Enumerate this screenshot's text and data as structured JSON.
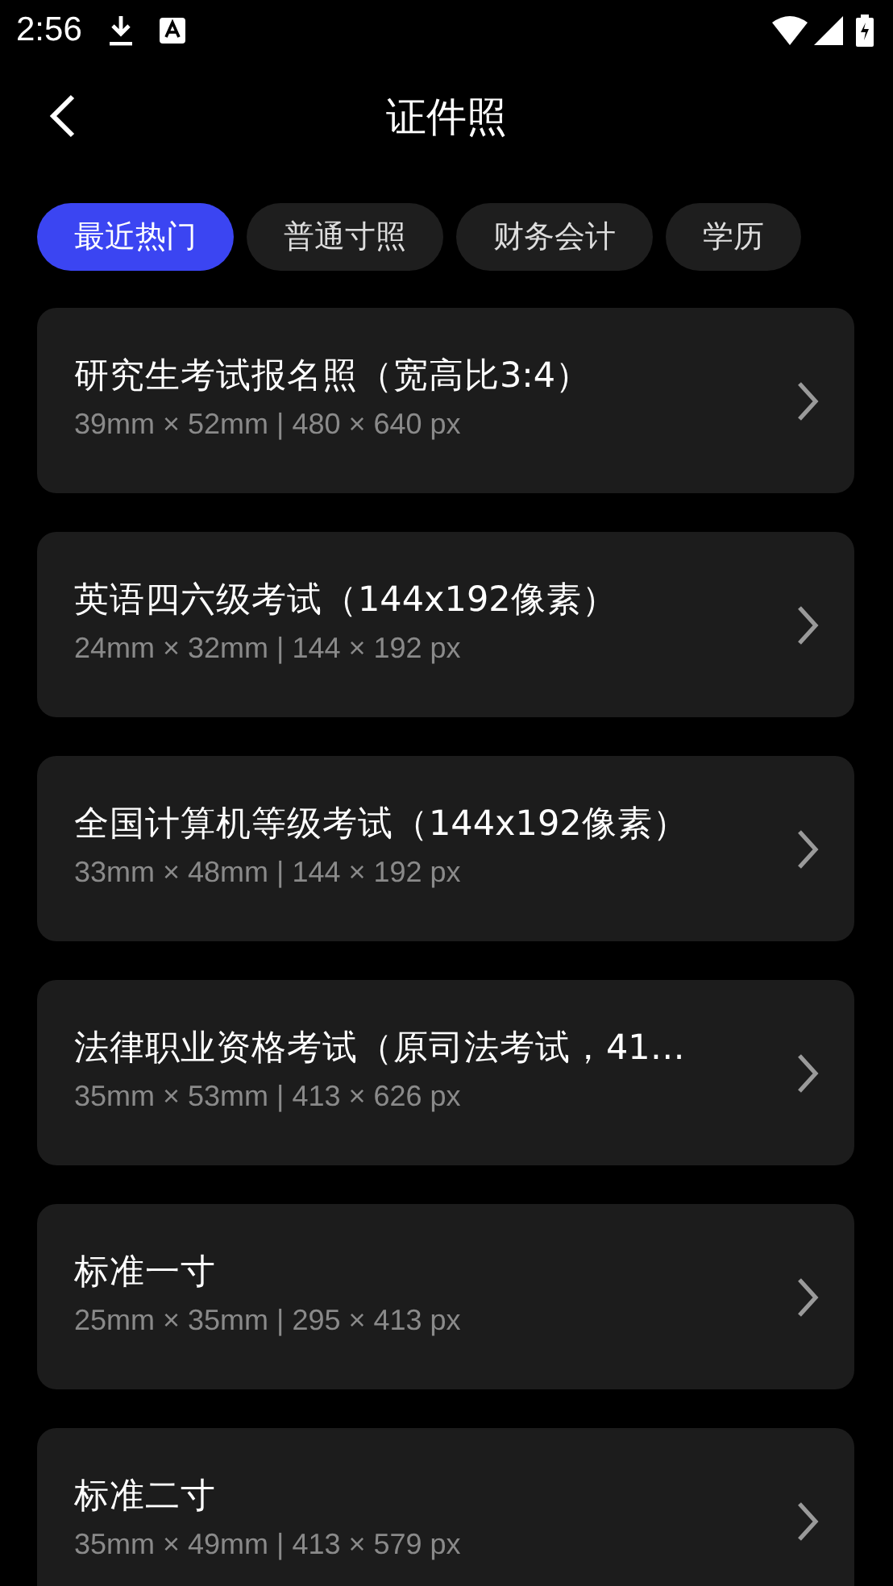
{
  "status_bar": {
    "time": "2:56"
  },
  "header": {
    "title": "证件照"
  },
  "tabs": [
    {
      "label": "最近热门",
      "selected": true
    },
    {
      "label": "普通寸照",
      "selected": false
    },
    {
      "label": "财务会计",
      "selected": false
    },
    {
      "label": "学历",
      "selected": false
    }
  ],
  "items": [
    {
      "title": "研究生考试报名照（宽高比3:4）",
      "size": "39mm × 52mm | 480 × 640 px"
    },
    {
      "title": "英语四六级考试（144x192像素）",
      "size": "24mm × 32mm | 144 × 192 px"
    },
    {
      "title": "全国计算机等级考试（144x192像素）",
      "size": "33mm × 48mm | 144 × 192 px"
    },
    {
      "title": "法律职业资格考试（原司法考试，41…",
      "size": "35mm × 53mm | 413 × 626 px"
    },
    {
      "title": "标准一寸",
      "size": "25mm × 35mm | 295 × 413 px"
    },
    {
      "title": "标准二寸",
      "size": "35mm × 49mm | 413 × 579 px"
    }
  ]
}
